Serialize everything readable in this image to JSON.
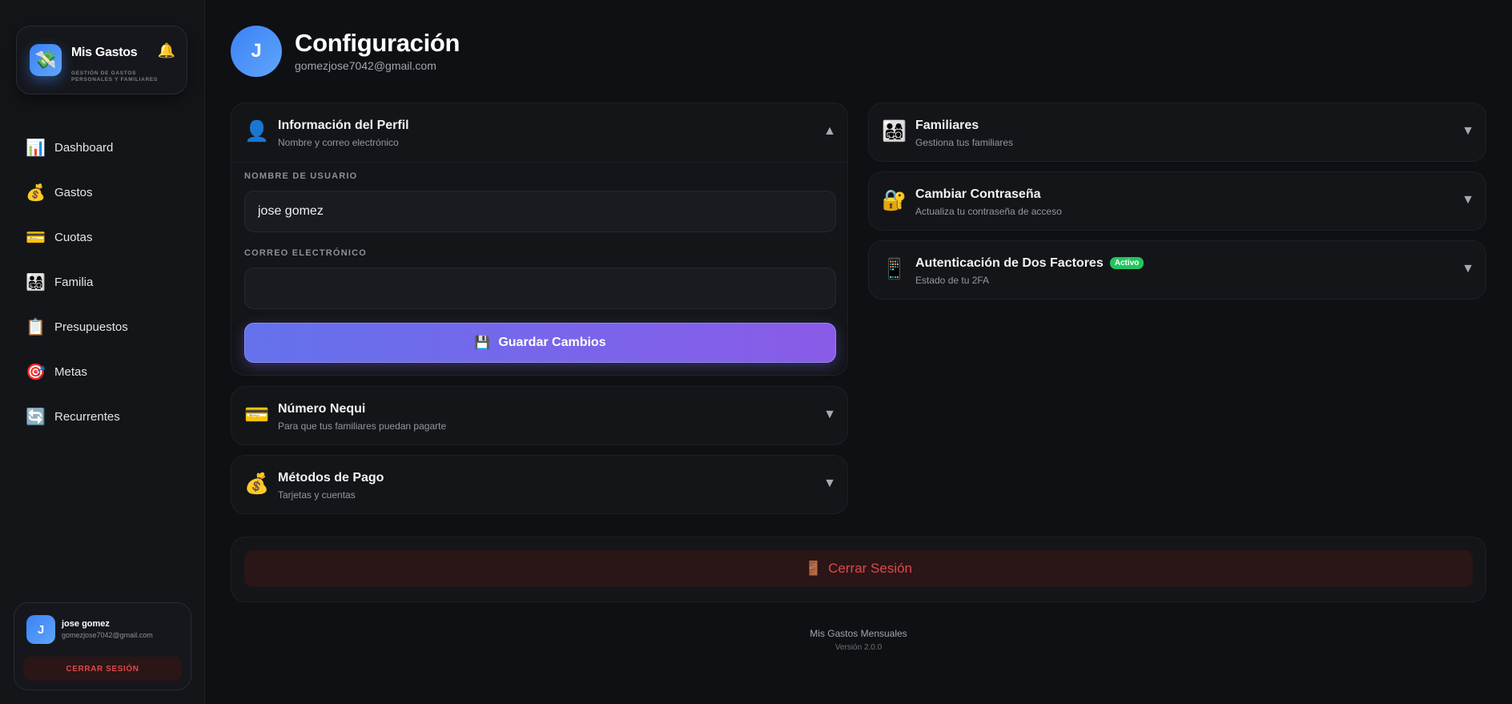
{
  "sidebar": {
    "brand": {
      "logo_icon": "money-wings-icon",
      "logo_glyph": "💸",
      "name": "Mis Gastos",
      "subtitle": "GESTIÓN DE GASTOS PERSONALES Y FAMILIARES",
      "bell_glyph": "🔔"
    },
    "nav": [
      {
        "label": "Dashboard",
        "icon": "chart-icon",
        "glyph": "📊"
      },
      {
        "label": "Gastos",
        "icon": "money-bag-icon",
        "glyph": "💰"
      },
      {
        "label": "Cuotas",
        "icon": "credit-card-icon",
        "glyph": "💳"
      },
      {
        "label": "Familia",
        "icon": "family-icon",
        "glyph": "👨‍👩‍👧‍👦"
      },
      {
        "label": "Presupuestos",
        "icon": "clipboard-icon",
        "glyph": "📋"
      },
      {
        "label": "Metas",
        "icon": "target-icon",
        "glyph": "🎯"
      },
      {
        "label": "Recurrentes",
        "icon": "repeat-icon",
        "glyph": "🔄"
      }
    ],
    "user": {
      "initial": "J",
      "name": "jose gomez",
      "email": "gomezjose7042@gmail.com",
      "logout_label": "CERRAR SESIÓN"
    }
  },
  "header": {
    "initial": "J",
    "title": "Configuración",
    "email": "gomezjose7042@gmail.com"
  },
  "profile": {
    "glyph": "👤",
    "title": "Información del Perfil",
    "subtitle": "Nombre y correo electrónico",
    "chevron": "▲",
    "username_label": "NOMBRE DE USUARIO",
    "username_value": "jose gomez",
    "email_label": "CORREO ELECTRÓNICO",
    "email_value": "",
    "save_glyph": "💾",
    "save_label": "Guardar Cambios"
  },
  "nequi": {
    "glyph": "💳",
    "title": "Número Nequi",
    "subtitle": "Para que tus familiares puedan pagarte",
    "chevron": "▼"
  },
  "payment": {
    "glyph": "💰",
    "title": "Métodos de Pago",
    "subtitle": "Tarjetas y cuentas",
    "chevron": "▼"
  },
  "family": {
    "glyph": "👨‍👩‍👧‍👦",
    "title": "Familiares",
    "subtitle": "Gestiona tus familiares",
    "chevron": "▼"
  },
  "password": {
    "glyph": "🔐",
    "title": "Cambiar Contraseña",
    "subtitle": "Actualiza tu contraseña de acceso",
    "chevron": "▼"
  },
  "twofa": {
    "glyph": "📱",
    "title": "Autenticación de Dos Factores",
    "badge": "Activo",
    "subtitle": "Estado de tu 2FA",
    "chevron": "▼"
  },
  "logout": {
    "glyph": "🚪",
    "label": "Cerrar Sesión"
  },
  "footer": {
    "name": "Mis Gastos Mensuales",
    "version": "Versión 2.0.0"
  },
  "colors": {
    "accent_gradient_start": "#6472ec",
    "accent_gradient_end": "#8a5be8",
    "danger": "#e04848",
    "success": "#22c55e",
    "avatar_blue": "#3b82f6"
  }
}
